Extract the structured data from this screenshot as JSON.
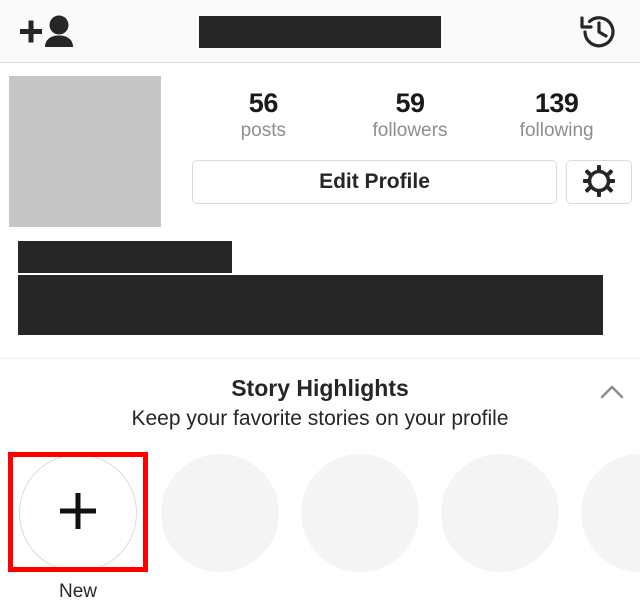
{
  "topbar": {
    "add_person_icon": "add-person-icon",
    "history_icon": "history-archive-icon",
    "username_redacted": ""
  },
  "profile": {
    "avatar_placeholder": "",
    "stats": [
      {
        "value": "56",
        "label": "posts"
      },
      {
        "value": "59",
        "label": "followers"
      },
      {
        "value": "139",
        "label": "following"
      }
    ],
    "edit_profile_label": "Edit Profile",
    "settings_icon": "gear-icon",
    "name_redacted": "",
    "bio_redacted": ""
  },
  "highlights": {
    "title": "Story Highlights",
    "subtitle": "Keep your favorite stories on your profile",
    "collapse_icon": "chevron-up-icon",
    "items": [
      {
        "label": "New",
        "type": "new",
        "plus_icon": "plus-icon"
      },
      {
        "label": "",
        "type": "placeholder"
      },
      {
        "label": "",
        "type": "placeholder"
      },
      {
        "label": "",
        "type": "placeholder"
      },
      {
        "label": "",
        "type": "placeholder"
      }
    ]
  },
  "colors": {
    "accent_focus": "#ff0000",
    "redaction": "#262626",
    "placeholder_gray": "#f4f4f4",
    "avatar_gray": "#c6c6c6",
    "muted_text": "#8e8e8e"
  }
}
